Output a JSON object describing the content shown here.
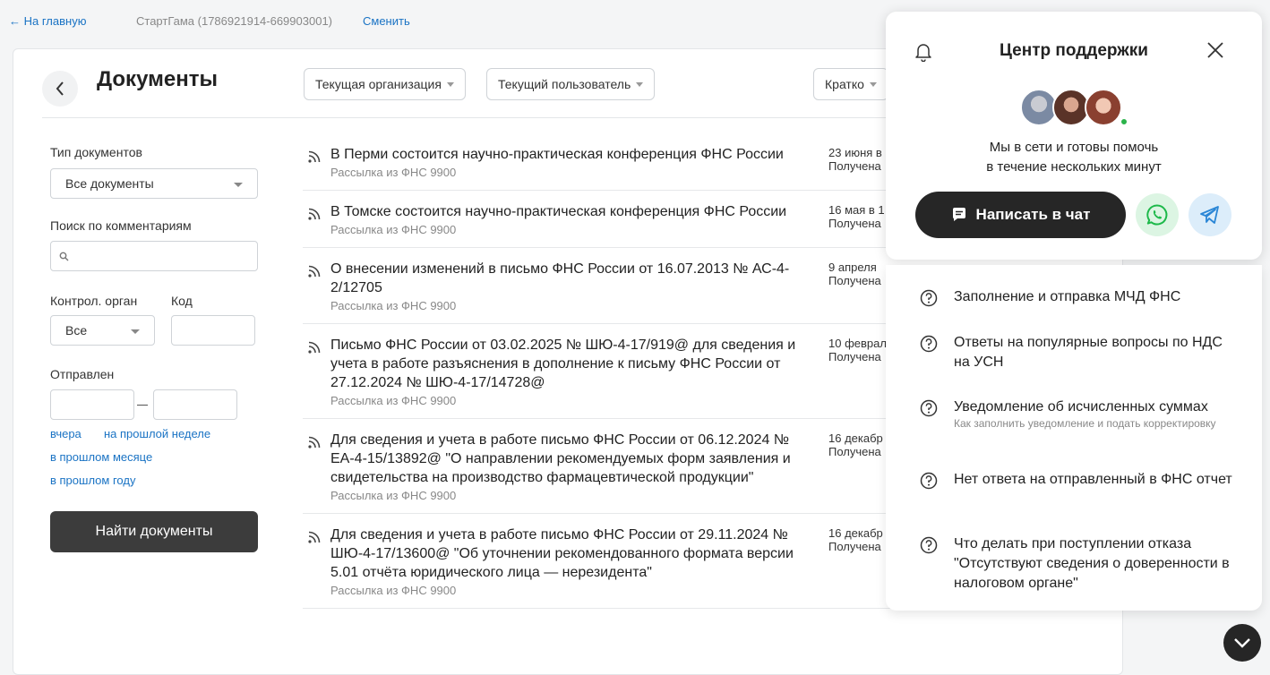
{
  "topbar": {
    "home": "← На главную",
    "org": "СтартГама (1786921914-669903001)",
    "change": "Сменить"
  },
  "header": {
    "title": "Документы",
    "back_icon": "chevron-left-icon",
    "filters": [
      "Текущая организация",
      "Текущий пользователь",
      "Кратко"
    ]
  },
  "sidebar": {
    "doc_type_label": "Тип документов",
    "doc_type_value": "Все документы",
    "comment_search_label": "Поиск по комментариям",
    "comment_search_value": "",
    "control_label": "Контрол. орган",
    "control_value": "Все",
    "code_label": "Код",
    "code_value": "",
    "sent_label": "Отправлен",
    "sent_from": "",
    "sent_to": "",
    "quick_links": [
      "вчера",
      "на прошлой неделе",
      "в прошлом месяце",
      "в прошлом году"
    ],
    "find_button": "Найти документы"
  },
  "documents": [
    {
      "title": "В Перми состоится научно-практическая конференция ФНС России",
      "source": "Рассылка из ФНС 9900",
      "date": "23 июня в",
      "status": "Получена"
    },
    {
      "title": "В Томске состоится научно-практическая конференция ФНС России",
      "source": "Рассылка из ФНС 9900",
      "date": "16 мая в 1",
      "status": "Получена"
    },
    {
      "title": "О внесении изменений в письмо ФНС России от 16.07.2013 № АС-4-2/12705",
      "source": "Рассылка из ФНС 9900",
      "date": "9 апреля",
      "status": "Получена"
    },
    {
      "title": "Письмо ФНС России от 03.02.2025 № ШЮ-4-17/919@ для сведения и учета в работе разъяснения в дополнение к письму ФНС России от 27.12.2024 № ШЮ-4-17/14728@",
      "source": "Рассылка из ФНС 9900",
      "date": "10 феврал",
      "status": "Получена"
    },
    {
      "title": "Для сведения и учета в работе письмо ФНС России от 06.12.2024 № ЕА-4-15/13892@ \"О направлении рекомендуемых форм заявления и свидетельства на производство фармацевтической продукции\"",
      "source": "Рассылка из ФНС 9900",
      "date": "16 декабр",
      "status": "Получена"
    },
    {
      "title": "Для сведения и учета в работе письмо ФНС России от 29.11.2024 № ШЮ-4-17/13600@ \"Об уточнении рекомендованного формата версии 5.01 отчёта юридического лица — нерезидента\"",
      "source": "Рассылка из ФНС 9900",
      "date": "16 декабр",
      "status": "Получена"
    }
  ],
  "support": {
    "title": "Центр поддержки",
    "bell_icon": "bell-icon",
    "close_icon": "close-icon",
    "message_line1": "Мы в сети и готовы помочь",
    "message_line2": "в течение нескольких минут",
    "chat_button": "Написать в чат",
    "whatsapp_icon": "whatsapp-icon",
    "telegram_icon": "telegram-icon",
    "online_color": "#2bb34a"
  },
  "faq": [
    {
      "title": "Заполнение и отправка МЧД ФНС",
      "subtitle": ""
    },
    {
      "title": "Ответы на популярные вопросы по НДС на УСН",
      "subtitle": ""
    },
    {
      "title": "Уведомление об исчисленных суммах",
      "subtitle": "Как заполнить уведомление и подать корректировку"
    },
    {
      "title": "Нет ответа на отправленный в ФНС отчет",
      "subtitle": ""
    },
    {
      "title": "Что делать при поступлении отказа \"Отсутствуют сведения о доверенности в налоговом органе\"",
      "subtitle": ""
    }
  ]
}
